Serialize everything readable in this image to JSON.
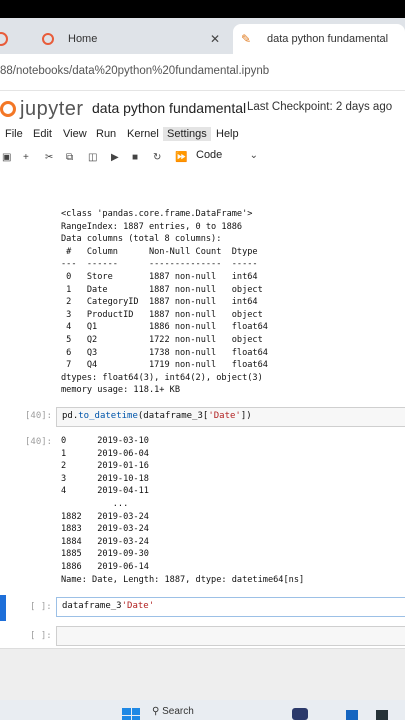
{
  "browser": {
    "tabs": [
      {
        "label": ""
      },
      {
        "label": "Home",
        "close": "✕"
      },
      {
        "label": "data python fundamental",
        "close": ""
      }
    ],
    "url": "88/notebooks/data%20python%20fundamental.ipynb"
  },
  "jupyter": {
    "logo_text": "jupyter",
    "notebook_title": "data python fundamental",
    "checkpoint": "Last Checkpoint: 2 days ago",
    "brand_color": "#f37726"
  },
  "menu": [
    "File",
    "Edit",
    "View",
    "Run",
    "Kernel",
    "Settings",
    "Help"
  ],
  "menu_active": "Settings",
  "toolbar": {
    "cell_type": "Code",
    "icons": [
      "save-icon",
      "add-cell-icon",
      "cut-icon",
      "copy-icon",
      "paste-icon",
      "run-icon",
      "stop-icon",
      "restart-icon",
      "fast-forward-icon"
    ]
  },
  "cells": {
    "info_output": "<class 'pandas.core.frame.DataFrame'>\nRangeIndex: 1887 entries, 0 to 1886\nData columns (total 8 columns):\n #   Column      Non-Null Count  Dtype  \n---  ------      --------------  -----  \n 0   Store       1887 non-null   int64  \n 1   Date        1887 non-null   object \n 2   CategoryID  1887 non-null   int64  \n 3   ProductID   1887 non-null   object \n 4   Q1          1886 non-null   float64\n 5   Q2          1722 non-null   object \n 6   Q3          1738 non-null   float64\n 7   Q4          1719 non-null   float64\ndtypes: float64(3), int64(2), object(3)\nmemory usage: 118.1+ KB",
    "cell40_prompt": "[40]:",
    "cell40_code_prefix": "pd.",
    "cell40_code_fn": "to_datetime",
    "cell40_code_arg1": "(dataframe_3[",
    "cell40_code_str": "'Date'",
    "cell40_code_end": "])",
    "cell40_out_prompt": "[40]:",
    "cell40_output": "0      2019-03-10\n1      2019-06-04\n2      2019-01-16\n3      2019-10-18\n4      2019-04-11\n          ...    \n1882   2019-03-24\n1883   2019-03-24\n1884   2019-03-24\n1885   2019-09-30\n1886   2019-06-14\nName: Date, Length: 1887, dtype: datetime64[ns]",
    "active_prompt": "[ ]:",
    "active_code_prefix": "dataframe_3",
    "active_code_str": "'Date'",
    "empty_prompt": "[ ]:"
  },
  "taskbar": {
    "search_label": "Search"
  }
}
